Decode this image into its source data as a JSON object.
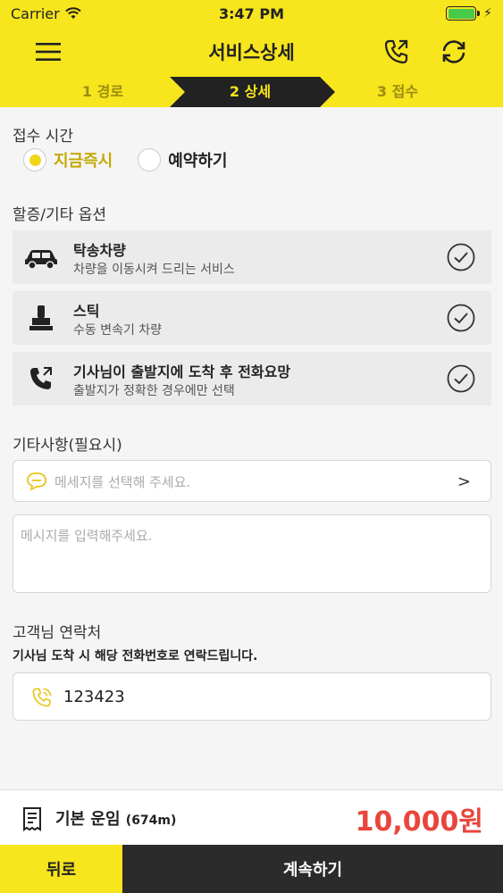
{
  "status_bar": {
    "carrier": "Carrier",
    "time": "3:47 PM"
  },
  "header": {
    "title": "서비스상세"
  },
  "steps": [
    {
      "label": "1 경로",
      "active": false
    },
    {
      "label": "2 상세",
      "active": true
    },
    {
      "label": "3 접수",
      "active": false
    }
  ],
  "reception": {
    "label": "접수 시간",
    "options": [
      {
        "label": "지금즉시",
        "selected": true
      },
      {
        "label": "예약하기",
        "selected": false
      }
    ]
  },
  "extra_options": {
    "label": "할증/기타 옵션",
    "items": [
      {
        "title": "탁송차량",
        "desc": "차량을 이동시켜 드리는 서비스",
        "icon": "car-icon"
      },
      {
        "title": "스틱",
        "desc": "수동 변속기 차량",
        "icon": "stick-shift-icon"
      },
      {
        "title": "기사님이 출발지에 도착 후 전화요망",
        "desc": "출발지가 정확한 경우에만 선택",
        "icon": "phone-icon"
      }
    ]
  },
  "notes": {
    "label": "기타사항(필요시)",
    "select_placeholder": "메세지를 선택해 주세요.",
    "textarea_placeholder": "메시지를 입력해주세요."
  },
  "contact": {
    "label": "고객님 연락처",
    "sub": "기사님 도착 시 해당 전화번호로 연락드립니다.",
    "phone": "123423"
  },
  "fare": {
    "label": "기본 운임",
    "distance": "(674m)",
    "amount": "10,000원"
  },
  "footer": {
    "back": "뒤로",
    "next": "계속하기"
  },
  "colors": {
    "accent": "#f7e51d",
    "price": "#e8453c",
    "dark": "#2b2b2b"
  }
}
